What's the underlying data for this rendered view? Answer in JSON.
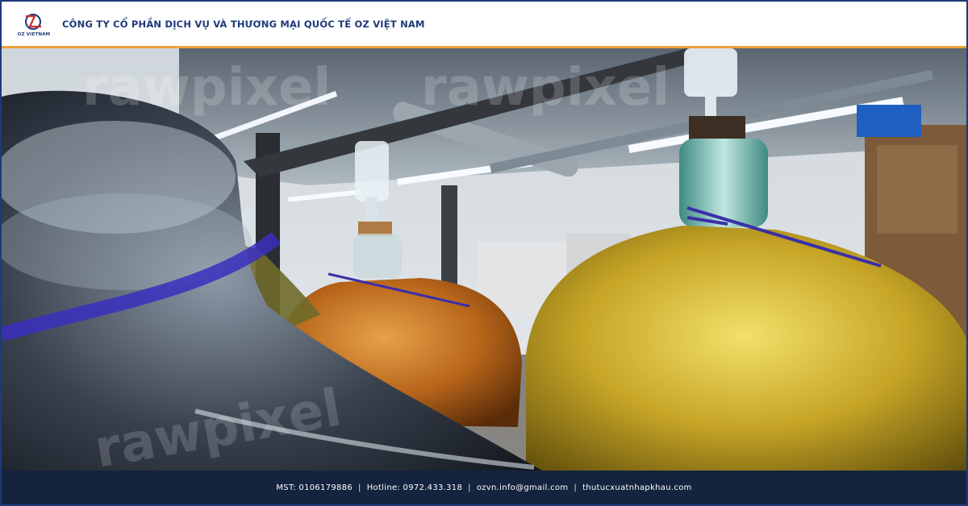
{
  "header": {
    "logo_text": "OZ VIETNAM",
    "company_name": "CÔNG TY CỔ PHẦN DỊCH VỤ VÀ THƯƠNG MẠI QUỐC TẾ OZ VIỆT NAM"
  },
  "photo": {
    "watermark": "rawpixel"
  },
  "footer": {
    "tax_code": "MST: 0106179886",
    "hotline": "Hotline: 0972.433.318",
    "email": "ozvn.info@gmail.com",
    "website": "thutucxuatnhapkhau.com",
    "separator": "|"
  },
  "colors": {
    "brand_blue": "#1d3a7a",
    "accent_orange": "#e8a33a",
    "footer_bg": "#14233e",
    "logo_red": "#d62b2b"
  }
}
